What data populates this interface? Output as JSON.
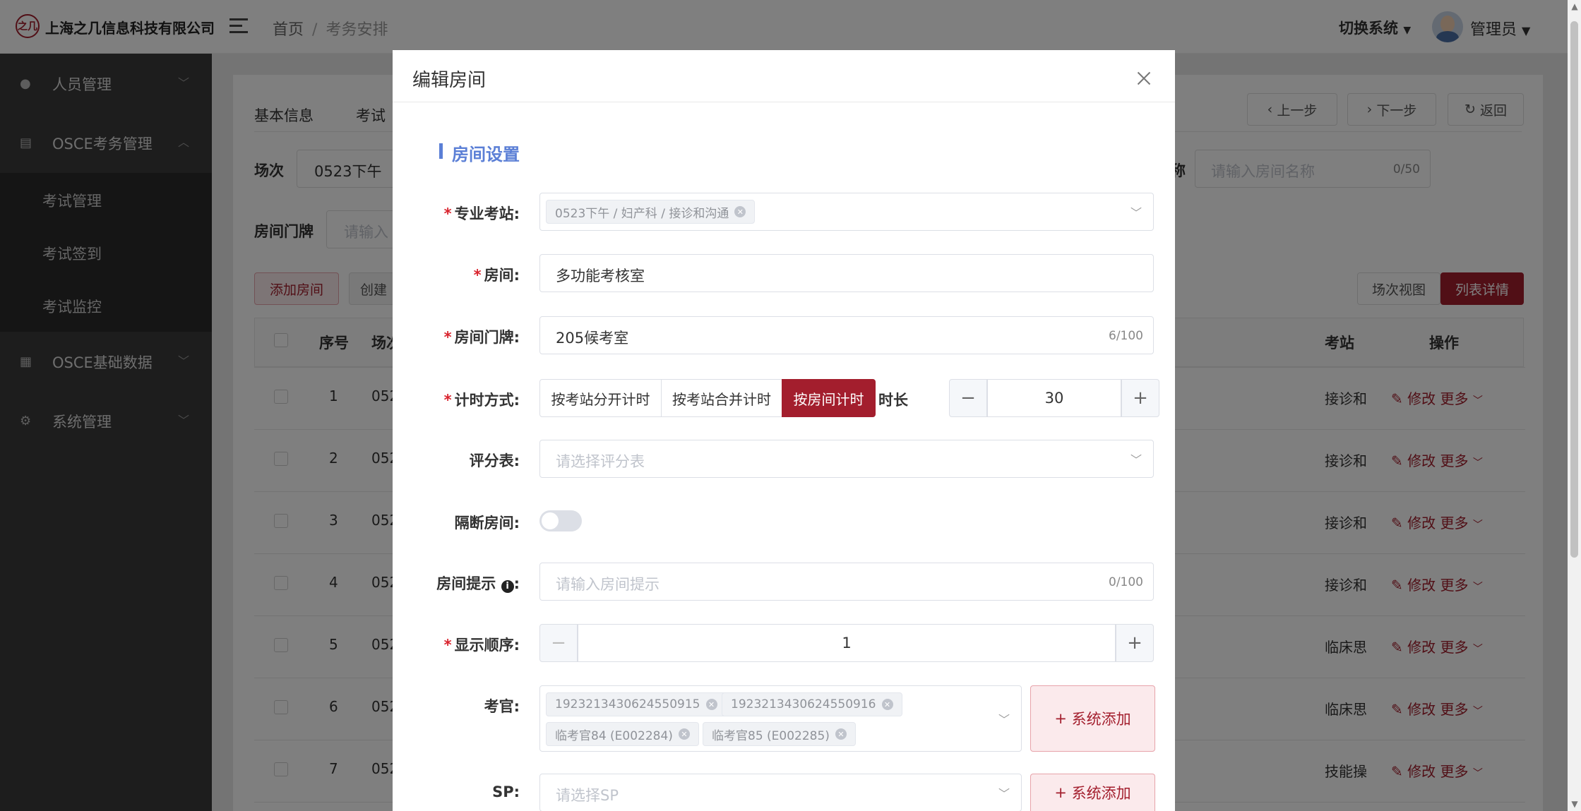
{
  "app": {
    "logo_text": "之几",
    "company": "上海之几信息科技有限公司",
    "switch_system": "切换系统",
    "admin": "管理员"
  },
  "breadcrumb": {
    "home": "首页",
    "sep": "/",
    "current": "考务安排"
  },
  "sidebar": {
    "items": [
      {
        "label": "人员管理"
      },
      {
        "label": "OSCE考务管理"
      },
      {
        "label": "OSCE基础数据"
      },
      {
        "label": "系统管理"
      }
    ],
    "sub_items": [
      {
        "label": "考试管理"
      },
      {
        "label": "考试签到"
      },
      {
        "label": "考试监控"
      }
    ]
  },
  "page": {
    "tab_basic": "基本信息",
    "tab_exam": "考试",
    "prev_label": "上一步",
    "next_label": "下一步",
    "back_label": "返回",
    "session_label": "场次",
    "session_value": "0523下午",
    "room_name_label_tail": "称",
    "room_name_placeholder": "请输入房间名称",
    "room_name_count": "0/50",
    "room_door_label": "房间门牌",
    "room_door_placeholder": "请输入",
    "add_room_label": "添加房间",
    "create_label": "创建",
    "session_view_label": "场次视图",
    "list_detail_label": "列表详情",
    "th_no": "序号",
    "th_session": "场次",
    "th_station": "考站",
    "th_ops": "操作",
    "rows": [
      {
        "no": "1",
        "session": "052",
        "station": "接诊和"
      },
      {
        "no": "2",
        "session": "052",
        "station": "接诊和"
      },
      {
        "no": "3",
        "session": "052",
        "station": "接诊和"
      },
      {
        "no": "4",
        "session": "052",
        "station": "接诊和"
      },
      {
        "no": "5",
        "session": "052",
        "station": "临床思"
      },
      {
        "no": "6",
        "session": "052",
        "station": "临床思"
      },
      {
        "no": "7",
        "session": "052",
        "station": "技能操"
      }
    ],
    "edit_label": "修改",
    "more_label": "更多"
  },
  "modal": {
    "title": "编辑房间",
    "section_title": "房间设置",
    "station": {
      "label": "专业考站:",
      "tag": "0523下午 / 妇产科 / 接诊和沟通"
    },
    "room": {
      "label": "房间:",
      "value": "多功能考核室"
    },
    "door": {
      "label": "房间门牌:",
      "value": "205候考室",
      "count": "6/100"
    },
    "timing": {
      "label": "计时方式:",
      "options": [
        "按考站分开计时",
        "按考站合并计时",
        "按房间计时"
      ],
      "selected": "按房间计时",
      "duration_label": "时长",
      "duration_value": "30"
    },
    "score": {
      "label": "评分表:",
      "placeholder": "请选择评分表"
    },
    "isolate": {
      "label": "隔断房间:",
      "on": false
    },
    "hint": {
      "label": "房间提示",
      "placeholder": "请输入房间提示",
      "count": "0/100"
    },
    "order": {
      "label": "显示顺序:",
      "value": "1"
    },
    "examiner": {
      "label": "考官:",
      "tags": [
        "1923213430624550915",
        "1923213430624550916",
        "临考官84 (E002284)",
        "临考官85 (E002285)"
      ],
      "add_label": "系统添加"
    },
    "sp": {
      "label": "SP:",
      "placeholder": "请选择SP",
      "add_label": "系统添加"
    }
  },
  "colors": {
    "brand": "#a31e2d",
    "section": "#5b7fd6",
    "sidebar": "#3b3b3b"
  }
}
